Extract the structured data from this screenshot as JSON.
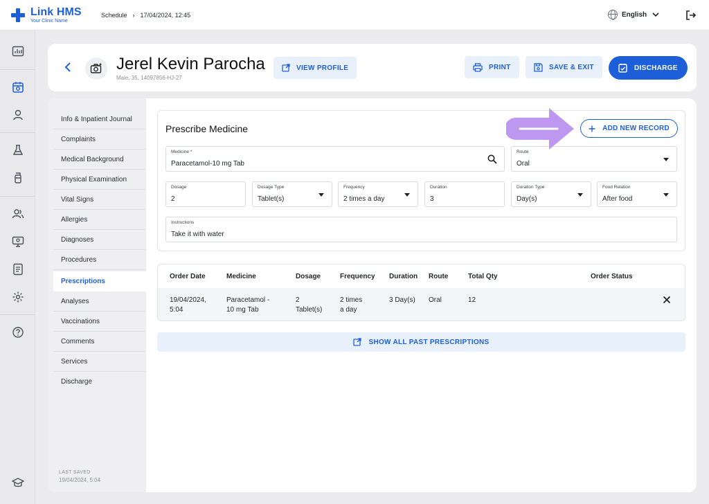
{
  "app": {
    "name": "Link HMS",
    "clinic_subtitle": "Your Clinic Name",
    "brand_color": "#1d5fd8",
    "language": "English"
  },
  "breadcrumb": {
    "section": "Schedule",
    "separator": "›",
    "current": "17/04/2024, 12:45"
  },
  "rail_icons": [
    "dashboard-icon",
    "calendar-icon",
    "user-icon",
    "flask-icon",
    "bottle-icon",
    "team-icon",
    "monitor-icon",
    "report-icon",
    "settings-icon",
    "help-icon",
    "graduation-cap-icon"
  ],
  "patient": {
    "name": "Jerel Kevin Parocha",
    "meta": "Male, 35, 14097856-HJ-27"
  },
  "actions": {
    "view_profile": "VIEW PROFILE",
    "print": "PRINT",
    "save_exit": "SAVE & EXIT",
    "discharge": "DISCHARGE"
  },
  "sidebar": {
    "items": [
      "Info & Inpatient Journal",
      "Complaints",
      "Medical Background",
      "Physical Examination",
      "Vital Signs",
      "Allergies",
      "Diagnoses",
      "Procedures",
      "Prescriptions",
      "Analyses",
      "Vaccinations",
      "Comments",
      "Services",
      "Discharge"
    ],
    "active_item": "Prescriptions",
    "last_saved_label": "LAST SAVED",
    "last_saved_value": "19/04/2024, 5:04"
  },
  "prescribe": {
    "title": "Prescribe Medicine",
    "add_button": "ADD NEW RECORD",
    "medicine": {
      "label": "Medicine *",
      "value": "Paracetamol-10 mg Tab"
    },
    "route": {
      "label": "Route",
      "value": "Oral"
    },
    "dosage": {
      "label": "Dosage",
      "value": "2"
    },
    "dosage_type": {
      "label": "Dosage Type",
      "value": "Tablet(s)"
    },
    "frequency": {
      "label": "Frequency",
      "value": "2 times a day"
    },
    "duration": {
      "label": "Duration",
      "value": "3"
    },
    "duration_type": {
      "label": "Duration Type",
      "value": "Day(s)"
    },
    "food_relation": {
      "label": "Food Relation",
      "value": "After food"
    },
    "instructions": {
      "label": "Instructions",
      "value": "Take it with water"
    }
  },
  "orders": {
    "columns": [
      "Order Date",
      "Medicine",
      "Dosage",
      "Frequency",
      "Duration",
      "Route",
      "Total Qty",
      "Order Status"
    ],
    "rows": [
      {
        "order_date": [
          "19/04/2024,",
          "5:04"
        ],
        "medicine": [
          "Paracetamol -",
          "10 mg Tab"
        ],
        "dosage": [
          "2",
          "Tablet(s)"
        ],
        "frequency": [
          "2 times",
          "a day"
        ],
        "duration": "3 Day(s)",
        "route": "Oral",
        "total_qty": "12",
        "order_status": ""
      }
    ]
  },
  "show_all": "SHOW ALL PAST PRESCRIPTIONS",
  "highlight_color": "#b98ef0"
}
